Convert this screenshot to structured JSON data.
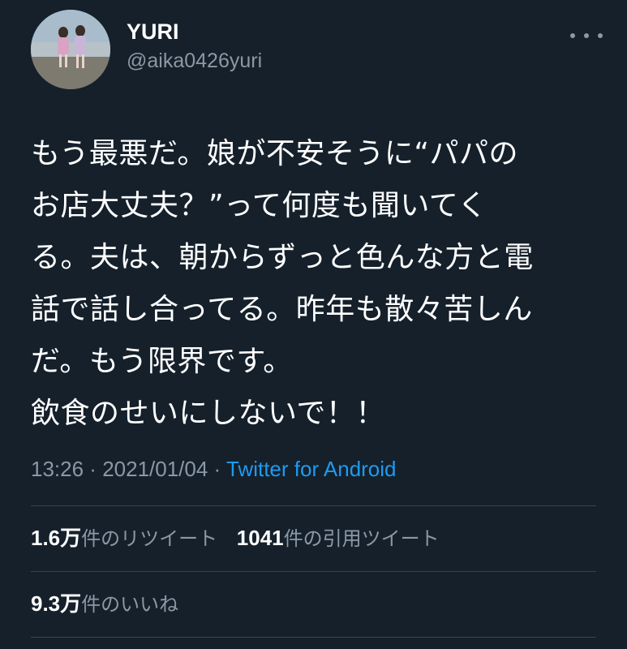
{
  "user": {
    "display_name": "YURI",
    "handle": "@aika0426yuri",
    "avatar_icon": "avatar-photo-two-children-at-beach"
  },
  "tweet": {
    "lines": [
      "もう最悪だ。娘が不安そうに“パパの",
      "お店大丈夫？”って何度も聞いてく",
      "る。夫は、朝からずっと色んな方と電",
      "話で話し合ってる。昨年も散々苦しん",
      "だ。もう限界です。",
      "飲食のせいにしないで！！"
    ]
  },
  "meta": {
    "time": "13:26",
    "separator1": " · ",
    "date": "2021/01/04",
    "separator2": " · ",
    "source": "Twitter for Android"
  },
  "stats": {
    "retweets_count": "1.6万",
    "retweets_label": "件のリツイート",
    "quotes_count": "1041",
    "quotes_label": "件の引用ツイート",
    "likes_count": "9.3万",
    "likes_label": "件のいいね"
  },
  "colors": {
    "background": "#15202b",
    "secondary_text": "#8b98a5",
    "link": "#1d9bf0",
    "divider": "#38444d"
  }
}
